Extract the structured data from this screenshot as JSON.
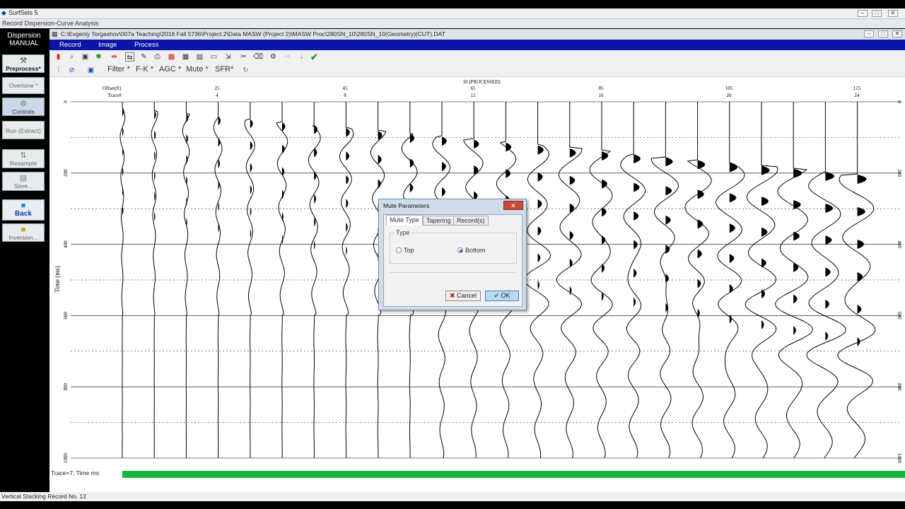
{
  "app": {
    "title": "SurfSeis 5",
    "subtitle": "Record Dispersion-Curve Analysis"
  },
  "left_panel": {
    "header_line1": "Dispersion",
    "header_line2": "MANUAL",
    "buttons": [
      "Preprocess*",
      "Overtone *",
      "Controls",
      "Run (Extract)",
      "Resample",
      "Save...",
      "Back",
      "Inversion..."
    ]
  },
  "document": {
    "path": "C:\\Evgeniy Torgashov\\007a Teaching\\2016 Fall 5736\\Project 2\\Data MASW (Project 2)\\MASW Proc\\280SN_10\\280SN_10(Geometry)(CUT).DAT"
  },
  "menu": {
    "items": [
      "Record",
      "Image",
      "Process"
    ]
  },
  "toolbar2": {
    "items": [
      "Filter *",
      "F-K *",
      "AGC *",
      "Mute *",
      "SFR*"
    ]
  },
  "plot": {
    "header_title": "10 (PROCESSED)",
    "offset_label": "Offset(ft)",
    "trace_label": "Trace#",
    "offset_ticks": [
      "25",
      "45",
      "65",
      "85",
      "105",
      "125"
    ],
    "trace_ticks": [
      "4",
      "8",
      "12",
      "16",
      "20",
      "24"
    ],
    "y_axis_label": "Time (ms)",
    "y_ticks": [
      "0",
      "200",
      "400",
      "600",
      "800",
      "1000"
    ]
  },
  "status": {
    "text": "Trace=7, Time ms",
    "progress": 1.0
  },
  "bottom_status": "Vertical Stacking Record No. 12",
  "dialog": {
    "title": "Mute Parameters",
    "close_label": "✕",
    "tabs": [
      "Mute Type",
      "Tapering",
      "Record(s)"
    ],
    "group_label": "Type",
    "options": [
      "Top",
      "Bottom"
    ],
    "selected": "Bottom",
    "cancel_label": "Cancel",
    "ok_label": "OK"
  }
}
